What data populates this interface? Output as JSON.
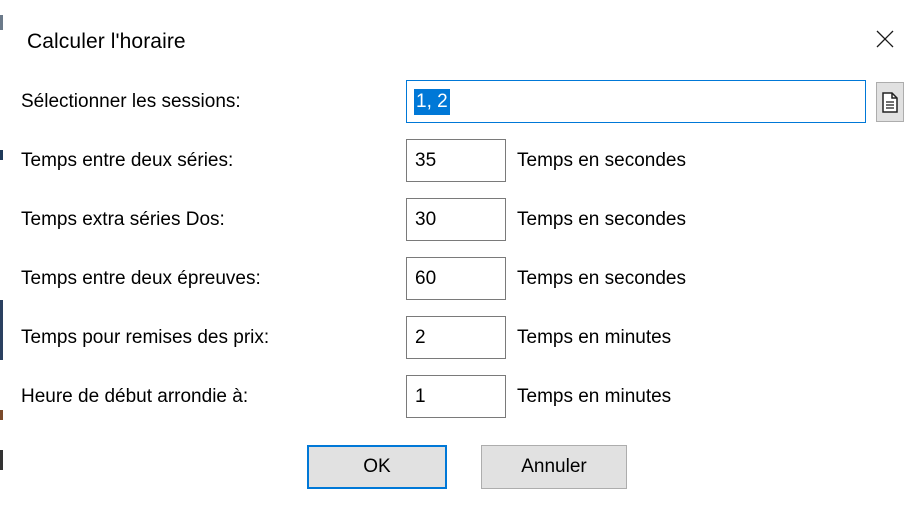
{
  "window": {
    "title": "Calculer l'horaire",
    "close_icon": "close-icon"
  },
  "sessions": {
    "label": "Sélectionner les sessions:",
    "value": "1, 2",
    "picker_icon": "document-icon"
  },
  "rows": [
    {
      "label": "Temps entre deux séries:",
      "value": "35",
      "unit": "Temps en secondes"
    },
    {
      "label": "Temps extra séries Dos:",
      "value": "30",
      "unit": "Temps en secondes"
    },
    {
      "label": "Temps entre deux épreuves:",
      "value": "60",
      "unit": "Temps en secondes"
    },
    {
      "label": "Temps pour remises des prix:",
      "value": "2",
      "unit": "Temps en minutes"
    },
    {
      "label": "Heure de début arrondie à:",
      "value": "1",
      "unit": "Temps en minutes"
    }
  ],
  "buttons": {
    "ok": "OK",
    "cancel": "Annuler"
  },
  "colors": {
    "accent": "#0078d7",
    "button_face": "#e1e1e1"
  }
}
